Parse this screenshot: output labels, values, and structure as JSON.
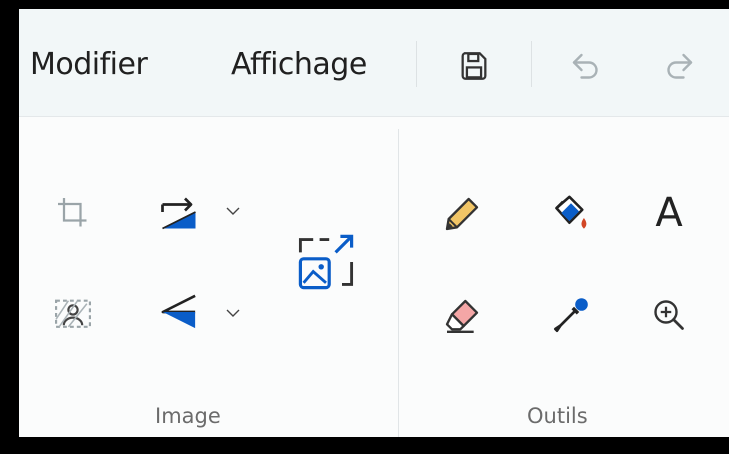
{
  "menu": {
    "modifier": "Modifier",
    "affichage": "Affichage"
  },
  "quick_access": {
    "icons": [
      "save-icon",
      "undo-icon",
      "redo-icon"
    ]
  },
  "ribbon": {
    "image_group": {
      "label": "Image",
      "icons": [
        "crop-icon",
        "rotate-icon",
        "select-icon",
        "flip-icon",
        "resize-icon"
      ]
    },
    "tools_group": {
      "label": "Outils",
      "icons": [
        "pencil-icon",
        "fill-bucket-icon",
        "text-icon",
        "eraser-icon",
        "color-picker-icon",
        "magnifier-icon"
      ]
    }
  },
  "text_tool_glyph": "A",
  "colors": {
    "accent_blue": "#0a5dc8",
    "fill_red": "#d24726",
    "pencil_yellow": "#f1c566",
    "eraser_pink": "#f4a6a6",
    "menubar_bg": "#f2f7f8"
  }
}
